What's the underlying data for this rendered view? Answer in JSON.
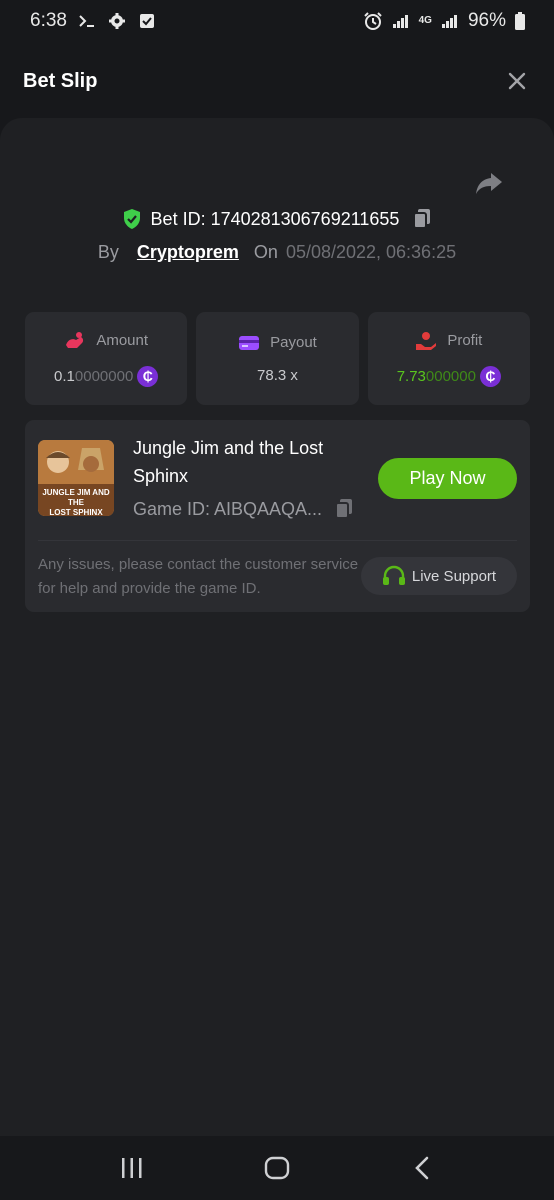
{
  "status_bar": {
    "time": "6:38",
    "battery": "96%",
    "network": "4G",
    "icons": [
      "terminal-icon",
      "gear-icon",
      "checkbox-icon",
      "alarm-icon",
      "signal-icon",
      "battery-icon"
    ]
  },
  "header": {
    "title": "Bet Slip",
    "close_icon": "close-icon"
  },
  "bet": {
    "id_label": "Bet ID: 1740281306769211655",
    "by_label": "By",
    "user": "Cryptoprem",
    "on_label": "On",
    "date": "05/08/2022, 06:36:25"
  },
  "stats": {
    "amount": {
      "label": "Amount",
      "value_bright": "0.1",
      "value_dim": "0000000"
    },
    "payout": {
      "label": "Payout",
      "value": "78.3 x"
    },
    "profit": {
      "label": "Profit",
      "value_bright": "7.73",
      "value_dim": "000000"
    }
  },
  "game": {
    "title": "Jungle Jim and the Lost Sphinx",
    "thumb_text_1": "JUNGLE JIM AND THE",
    "thumb_text_2": "LOST SPHINX",
    "id_text": "Game ID: AIBQAAQA...",
    "play_label": "Play Now",
    "help_text": "Any issues, please contact the customer service for help and provide the game ID.",
    "support_label": "Live Support"
  },
  "colors": {
    "accent_green": "#5ab817",
    "coin_purple": "#7a2fd6",
    "shield_green": "#3fcf4a"
  }
}
